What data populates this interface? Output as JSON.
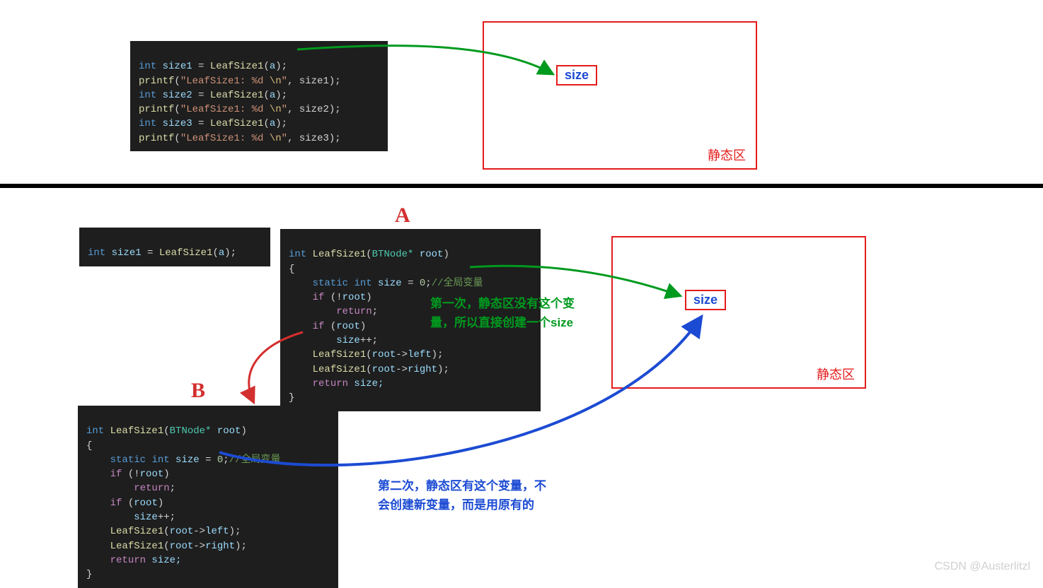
{
  "top": {
    "code_main": {
      "l1": {
        "a": "int",
        "b": " size1 ",
        "c": "=",
        "d": " LeafSize1",
        "e": "(",
        "f": "a",
        "g": ");"
      },
      "l2": {
        "a": "printf",
        "b": "(",
        "c": "\"LeafSize1: %d ",
        "d": "\\n",
        "e": "\"",
        "f": ", size1);"
      },
      "l3": {
        "a": "int",
        "b": " size2 ",
        "c": "=",
        "d": " LeafSize1",
        "e": "(",
        "f": "a",
        "g": ");"
      },
      "l4": {
        "a": "printf",
        "b": "(",
        "c": "\"LeafSize1: %d ",
        "d": "\\n",
        "e": "\"",
        "f": ", size2);"
      },
      "l5": {
        "a": "int",
        "b": " size3 ",
        "c": "=",
        "d": " LeafSize1",
        "e": "(",
        "f": "a",
        "g": ");"
      },
      "l6": {
        "a": "printf",
        "b": "(",
        "c": "\"LeafSize1: %d ",
        "d": "\\n",
        "e": "\"",
        "f": ", size3);"
      }
    },
    "static_label": "静态区",
    "size_chip": "size"
  },
  "divider": "",
  "bottom": {
    "label_A": "A",
    "label_B": "B",
    "call_line": {
      "a": "int",
      "b": " size1 ",
      "c": "=",
      "d": " LeafSize1",
      "e": "(",
      "f": "a",
      "g": ");"
    },
    "func_code": {
      "sig": {
        "a": "int",
        "b": " LeafSize1",
        "c": "(",
        "d": "BTNode*",
        "e": " root",
        "f": ")"
      },
      "open": "{",
      "s1": {
        "a": "static",
        "b": " ",
        "c": "int",
        "d": " size ",
        "e": "=",
        "f": " ",
        "g": "0",
        "h": ";",
        "i": "//全局变量"
      },
      "s2": {
        "a": "if",
        "b": " (",
        "c": "!",
        "d": "root",
        "e": ")"
      },
      "s3": {
        "a": "return",
        "b": ";"
      },
      "s4": {
        "a": "if",
        "b": " (",
        "c": "root",
        "d": ")"
      },
      "s5": {
        "a": "size",
        "b": "++;"
      },
      "s6": {
        "a": "LeafSize1",
        "b": "(",
        "c": "root",
        "d": "->",
        "e": "left",
        "f": ");"
      },
      "s7": {
        "a": "LeafSize1",
        "b": "(",
        "c": "root",
        "d": "->",
        "e": "right",
        "f": ");"
      },
      "s8": {
        "a": "return",
        "b": " size;"
      },
      "close": "}"
    },
    "annot_green": "第一次，静态区没有这个变\n量，所以直接创建一个size",
    "annot_blue": "第二次，静态区有这个变量，不\n会创建新变量，而是用原有的",
    "static_label": "静态区",
    "size_chip": "size",
    "watermark": "CSDN @Austerlitzl"
  }
}
